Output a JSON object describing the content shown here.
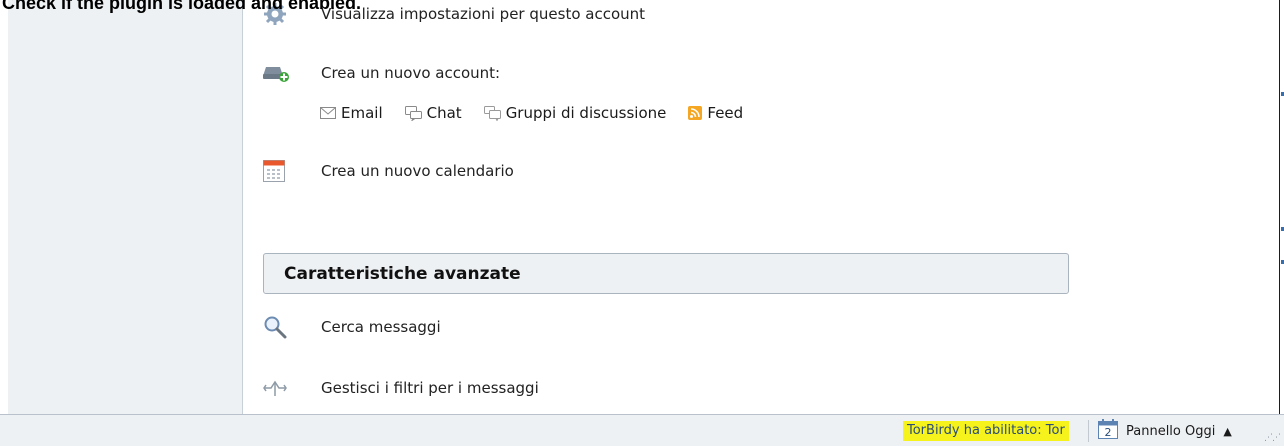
{
  "caption": "Check if the plugin is loaded and enabled.",
  "actions": {
    "view_settings": "Visualizza impostazioni per questo account",
    "create_account": "Crea un nuovo account:",
    "account_types": [
      "Email",
      "Chat",
      "Gruppi di discussione",
      "Feed"
    ],
    "create_calendar": "Crea un nuovo calendario"
  },
  "advanced": {
    "title": "Caratteristiche avanzate",
    "search_messages": "Cerca messaggi",
    "manage_filters": "Gestisci i filtri per i messaggi"
  },
  "statusbar": {
    "torbirdy": "TorBirdy ha abilitato: Tor",
    "today_pane": "Pannello Oggi",
    "calendar_day": "2"
  },
  "colors": {
    "highlight": "#f6f21b",
    "pane_bg": "#eef1f4",
    "feed_orange": "#f5a623"
  }
}
